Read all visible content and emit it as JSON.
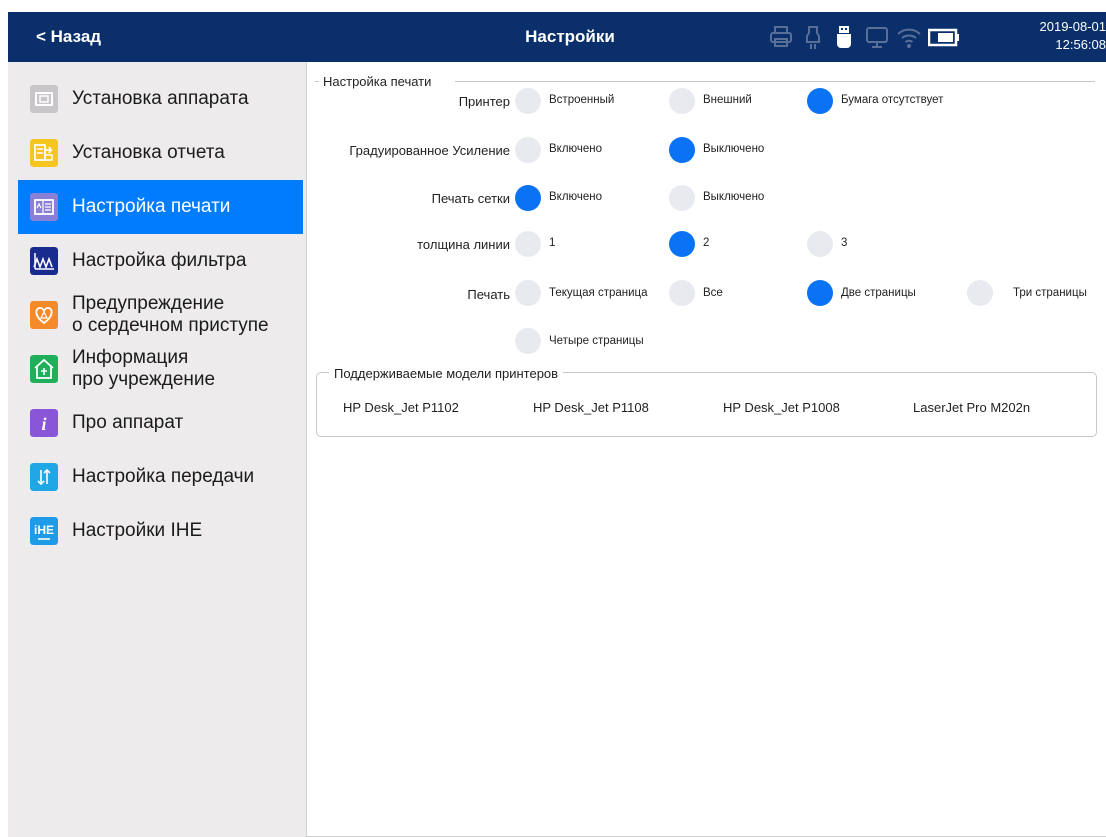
{
  "header": {
    "back_label": "< Назад",
    "title": "Настройки",
    "date": "2019-08-01",
    "time": "12:56:08",
    "status_icons": [
      "printer-icon",
      "usb-icon",
      "usb-stick-icon",
      "display-icon",
      "wifi-icon",
      "battery-icon"
    ]
  },
  "sidebar": {
    "items": [
      {
        "label": "Установка аппарата",
        "icon": "device-icon",
        "color": "#c8c6c8"
      },
      {
        "label": "Установка отчета",
        "icon": "report-icon",
        "color": "#f7c520"
      },
      {
        "label": "Настройка печати",
        "icon": "print-settings-icon",
        "color": "#8a7fd6",
        "active": true
      },
      {
        "label": "Настройка фильтра",
        "icon": "filter-wave-icon",
        "color": "#1a2b8f"
      },
      {
        "label": "Предупреждение\nо сердечном приступе",
        "icon": "heart-warning-icon",
        "color": "#f58a2a"
      },
      {
        "label": "Информация\nпро учреждение",
        "icon": "institution-icon",
        "color": "#1fae5a"
      },
      {
        "label": "Про аппарат",
        "icon": "info-icon",
        "color": "#8a56d8"
      },
      {
        "label": "Настройка передачи",
        "icon": "transfer-icon",
        "color": "#20a8e6"
      },
      {
        "label": "Настройки IHE",
        "icon": "ihe-icon",
        "color": "#1e9be6"
      }
    ]
  },
  "print_settings": {
    "legend": "Настройка печати",
    "printer": {
      "label": "Принтер",
      "options": [
        "Встроенный",
        "Внешний",
        "Бумага отсутствует"
      ],
      "selected": 2
    },
    "graded_gain": {
      "label": "Градуированное Усиление",
      "options": [
        "Включено",
        "Выключено"
      ],
      "selected": 1
    },
    "grid_print": {
      "label": "Печать сетки",
      "options": [
        "Включено",
        "Выключено"
      ],
      "selected": 0
    },
    "line_width": {
      "label": "толщина линии",
      "options": [
        "1",
        "2",
        "3"
      ],
      "selected": 1
    },
    "print": {
      "label": "Печать",
      "options": [
        "Текущая страница",
        "Все",
        "Две страницы",
        "Три страницы",
        "Четыре страницы"
      ],
      "selected": 2
    }
  },
  "printer_models": {
    "legend": "Поддерживаемые модели принтеров",
    "models": [
      "HP Desk_Jet P1102",
      "HP Desk_Jet P1108",
      "HP Desk_Jet P1008",
      "LaserJet Pro M202n"
    ]
  },
  "colors": {
    "header_bg": "#0a2f6b",
    "accent": "#007cff",
    "radio_on": "#0a73f5",
    "radio_off": "#e8eaef",
    "sidebar_bg": "#edebec"
  }
}
